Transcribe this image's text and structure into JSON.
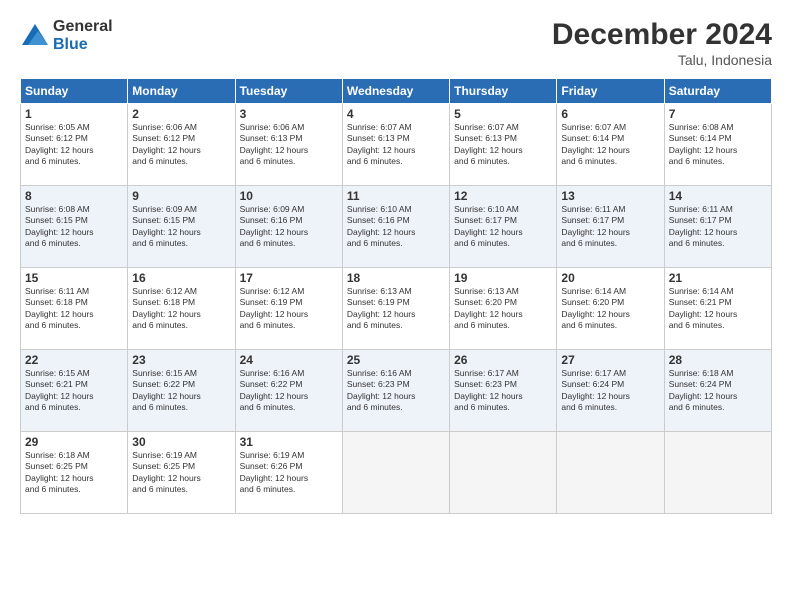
{
  "logo": {
    "general": "General",
    "blue": "Blue"
  },
  "title": "December 2024",
  "location": "Talu, Indonesia",
  "days_of_week": [
    "Sunday",
    "Monday",
    "Tuesday",
    "Wednesday",
    "Thursday",
    "Friday",
    "Saturday"
  ],
  "weeks": [
    [
      {
        "day": "1",
        "sunrise": "6:05 AM",
        "sunset": "6:12 PM",
        "daylight": "12 hours and 6 minutes."
      },
      {
        "day": "2",
        "sunrise": "6:06 AM",
        "sunset": "6:12 PM",
        "daylight": "12 hours and 6 minutes."
      },
      {
        "day": "3",
        "sunrise": "6:06 AM",
        "sunset": "6:13 PM",
        "daylight": "12 hours and 6 minutes."
      },
      {
        "day": "4",
        "sunrise": "6:07 AM",
        "sunset": "6:13 PM",
        "daylight": "12 hours and 6 minutes."
      },
      {
        "day": "5",
        "sunrise": "6:07 AM",
        "sunset": "6:13 PM",
        "daylight": "12 hours and 6 minutes."
      },
      {
        "day": "6",
        "sunrise": "6:07 AM",
        "sunset": "6:14 PM",
        "daylight": "12 hours and 6 minutes."
      },
      {
        "day": "7",
        "sunrise": "6:08 AM",
        "sunset": "6:14 PM",
        "daylight": "12 hours and 6 minutes."
      }
    ],
    [
      {
        "day": "8",
        "sunrise": "6:08 AM",
        "sunset": "6:15 PM",
        "daylight": "12 hours and 6 minutes."
      },
      {
        "day": "9",
        "sunrise": "6:09 AM",
        "sunset": "6:15 PM",
        "daylight": "12 hours and 6 minutes."
      },
      {
        "day": "10",
        "sunrise": "6:09 AM",
        "sunset": "6:16 PM",
        "daylight": "12 hours and 6 minutes."
      },
      {
        "day": "11",
        "sunrise": "6:10 AM",
        "sunset": "6:16 PM",
        "daylight": "12 hours and 6 minutes."
      },
      {
        "day": "12",
        "sunrise": "6:10 AM",
        "sunset": "6:17 PM",
        "daylight": "12 hours and 6 minutes."
      },
      {
        "day": "13",
        "sunrise": "6:11 AM",
        "sunset": "6:17 PM",
        "daylight": "12 hours and 6 minutes."
      },
      {
        "day": "14",
        "sunrise": "6:11 AM",
        "sunset": "6:17 PM",
        "daylight": "12 hours and 6 minutes."
      }
    ],
    [
      {
        "day": "15",
        "sunrise": "6:11 AM",
        "sunset": "6:18 PM",
        "daylight": "12 hours and 6 minutes."
      },
      {
        "day": "16",
        "sunrise": "6:12 AM",
        "sunset": "6:18 PM",
        "daylight": "12 hours and 6 minutes."
      },
      {
        "day": "17",
        "sunrise": "6:12 AM",
        "sunset": "6:19 PM",
        "daylight": "12 hours and 6 minutes."
      },
      {
        "day": "18",
        "sunrise": "6:13 AM",
        "sunset": "6:19 PM",
        "daylight": "12 hours and 6 minutes."
      },
      {
        "day": "19",
        "sunrise": "6:13 AM",
        "sunset": "6:20 PM",
        "daylight": "12 hours and 6 minutes."
      },
      {
        "day": "20",
        "sunrise": "6:14 AM",
        "sunset": "6:20 PM",
        "daylight": "12 hours and 6 minutes."
      },
      {
        "day": "21",
        "sunrise": "6:14 AM",
        "sunset": "6:21 PM",
        "daylight": "12 hours and 6 minutes."
      }
    ],
    [
      {
        "day": "22",
        "sunrise": "6:15 AM",
        "sunset": "6:21 PM",
        "daylight": "12 hours and 6 minutes."
      },
      {
        "day": "23",
        "sunrise": "6:15 AM",
        "sunset": "6:22 PM",
        "daylight": "12 hours and 6 minutes."
      },
      {
        "day": "24",
        "sunrise": "6:16 AM",
        "sunset": "6:22 PM",
        "daylight": "12 hours and 6 minutes."
      },
      {
        "day": "25",
        "sunrise": "6:16 AM",
        "sunset": "6:23 PM",
        "daylight": "12 hours and 6 minutes."
      },
      {
        "day": "26",
        "sunrise": "6:17 AM",
        "sunset": "6:23 PM",
        "daylight": "12 hours and 6 minutes."
      },
      {
        "day": "27",
        "sunrise": "6:17 AM",
        "sunset": "6:24 PM",
        "daylight": "12 hours and 6 minutes."
      },
      {
        "day": "28",
        "sunrise": "6:18 AM",
        "sunset": "6:24 PM",
        "daylight": "12 hours and 6 minutes."
      }
    ],
    [
      {
        "day": "29",
        "sunrise": "6:18 AM",
        "sunset": "6:25 PM",
        "daylight": "12 hours and 6 minutes."
      },
      {
        "day": "30",
        "sunrise": "6:19 AM",
        "sunset": "6:25 PM",
        "daylight": "12 hours and 6 minutes."
      },
      {
        "day": "31",
        "sunrise": "6:19 AM",
        "sunset": "6:26 PM",
        "daylight": "12 hours and 6 minutes."
      },
      null,
      null,
      null,
      null
    ]
  ],
  "labels": {
    "sunrise": "Sunrise:",
    "sunset": "Sunset:",
    "daylight": "Daylight:"
  }
}
